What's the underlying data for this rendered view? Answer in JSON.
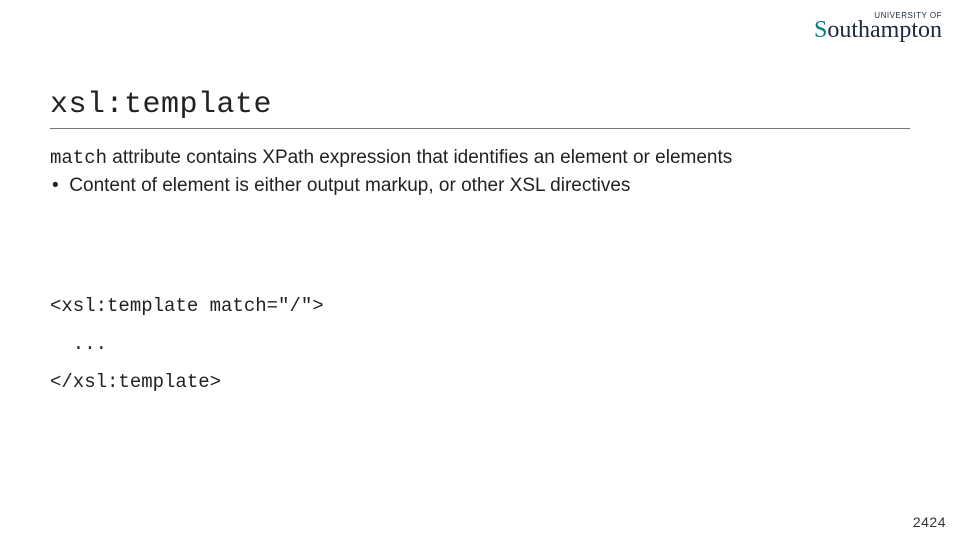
{
  "logo": {
    "top": "UNIVERSITY OF",
    "main_prefix": "S",
    "main_rest": "outhampton"
  },
  "title": "xsl:template",
  "line1": {
    "kw": "match",
    "rest": " attribute contains XPath expression that identifies an element or elements"
  },
  "bullet": {
    "dot": "•",
    "text": " Content of element is either output markup, or other XSL directives"
  },
  "code": {
    "l1": "<xsl:template match=\"/\">",
    "l2": "  ...",
    "l3": "</xsl:template>"
  },
  "pagenum": "2424"
}
